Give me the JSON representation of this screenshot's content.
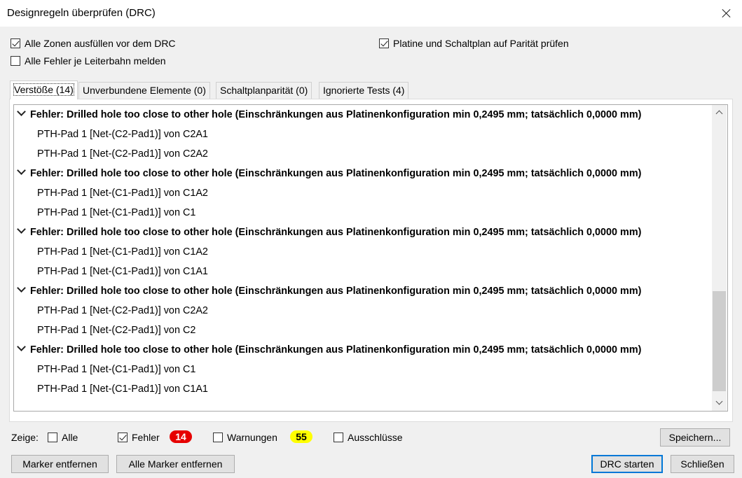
{
  "window": {
    "title": "Designregeln überprüfen (DRC)"
  },
  "options": {
    "fill_zones": {
      "label": "Alle Zonen ausfüllen vor dem DRC",
      "checked": true
    },
    "all_track_errors": {
      "label": "Alle Fehler je Leiterbahn melden",
      "checked": false
    },
    "parity": {
      "label": "Platine und Schaltplan auf Parität prüfen",
      "checked": true
    }
  },
  "tabs": [
    {
      "label": "Verstöße (14)",
      "active": true
    },
    {
      "label": "Unverbundene Elemente (0)",
      "active": false
    },
    {
      "label": "Schaltplanparität (0)",
      "active": false
    },
    {
      "label": "Ignorierte Tests (4)",
      "active": false
    }
  ],
  "violations": [
    {
      "header": "Fehler: Drilled hole too close to other hole (Einschränkungen aus Platinenkonfiguration min 0,2495 mm; tatsächlich 0,0000 mm)",
      "items": [
        "PTH-Pad 1 [Net-(C2-Pad1)] von C2A1",
        "PTH-Pad 1 [Net-(C2-Pad1)] von C2A2"
      ]
    },
    {
      "header": "Fehler: Drilled hole too close to other hole (Einschränkungen aus Platinenkonfiguration min 0,2495 mm; tatsächlich 0,0000 mm)",
      "items": [
        "PTH-Pad 1 [Net-(C1-Pad1)] von C1A2",
        "PTH-Pad 1 [Net-(C1-Pad1)] von C1"
      ]
    },
    {
      "header": "Fehler: Drilled hole too close to other hole (Einschränkungen aus Platinenkonfiguration min 0,2495 mm; tatsächlich 0,0000 mm)",
      "items": [
        "PTH-Pad 1 [Net-(C1-Pad1)] von C1A2",
        "PTH-Pad 1 [Net-(C1-Pad1)] von C1A1"
      ]
    },
    {
      "header": "Fehler: Drilled hole too close to other hole (Einschränkungen aus Platinenkonfiguration min 0,2495 mm; tatsächlich 0,0000 mm)",
      "items": [
        "PTH-Pad 1 [Net-(C2-Pad1)] von C2A2",
        "PTH-Pad 1 [Net-(C2-Pad1)] von C2"
      ]
    },
    {
      "header": "Fehler: Drilled hole too close to other hole (Einschränkungen aus Platinenkonfiguration min 0,2495 mm; tatsächlich 0,0000 mm)",
      "items": [
        "PTH-Pad 1 [Net-(C1-Pad1)] von C1",
        "PTH-Pad 1 [Net-(C1-Pad1)] von C1A1"
      ]
    }
  ],
  "scrollbar": {
    "thumb_start": 0.62,
    "thumb_end": 0.98
  },
  "filter": {
    "label": "Zeige:",
    "all": {
      "label": "Alle",
      "checked": false
    },
    "errors": {
      "label": "Fehler",
      "checked": true,
      "count": "14",
      "badge_color": "#e60000"
    },
    "warnings": {
      "label": "Warnungen",
      "checked": false,
      "count": "55",
      "badge_color": "#ffff00"
    },
    "exclusions": {
      "label": "Ausschlüsse",
      "checked": false
    }
  },
  "buttons": {
    "save": "Speichern...",
    "remove_marker": "Marker entfernen",
    "remove_all_markers": "Alle Marker entfernen",
    "run_drc": "DRC starten",
    "close": "Schließen"
  }
}
